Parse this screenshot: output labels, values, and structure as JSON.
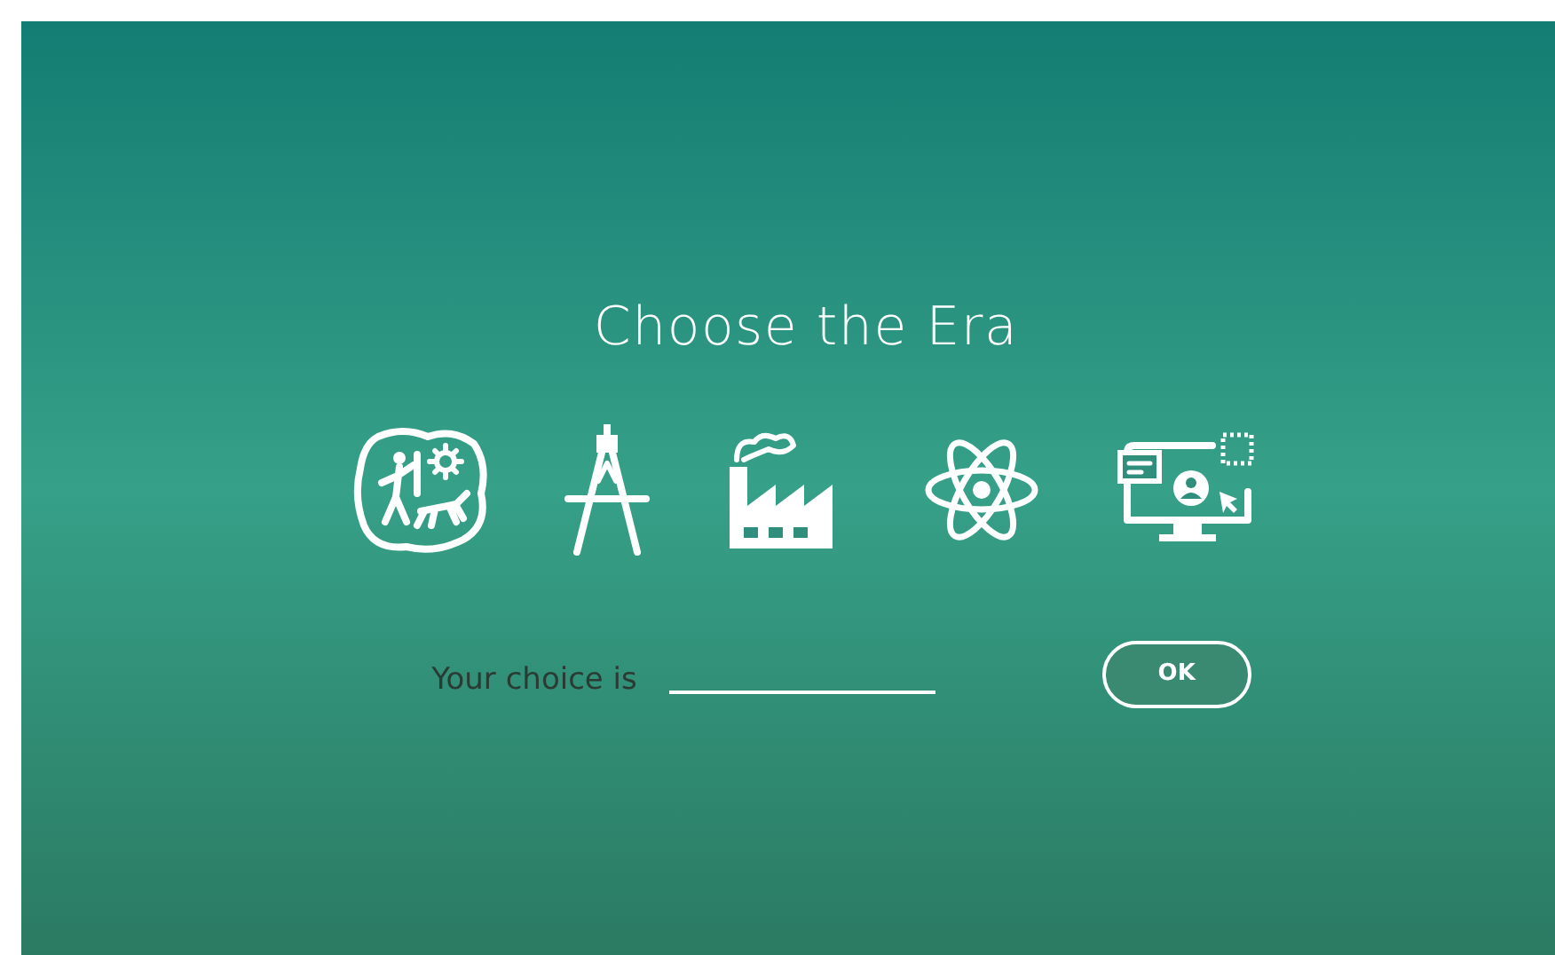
{
  "title": "Choose the Era",
  "eras": [
    {
      "kind": "prehistory"
    },
    {
      "kind": "compass"
    },
    {
      "kind": "factory"
    },
    {
      "kind": "atom"
    },
    {
      "kind": "computer"
    }
  ],
  "prompt": "Your choice is",
  "ok_button": "OK"
}
